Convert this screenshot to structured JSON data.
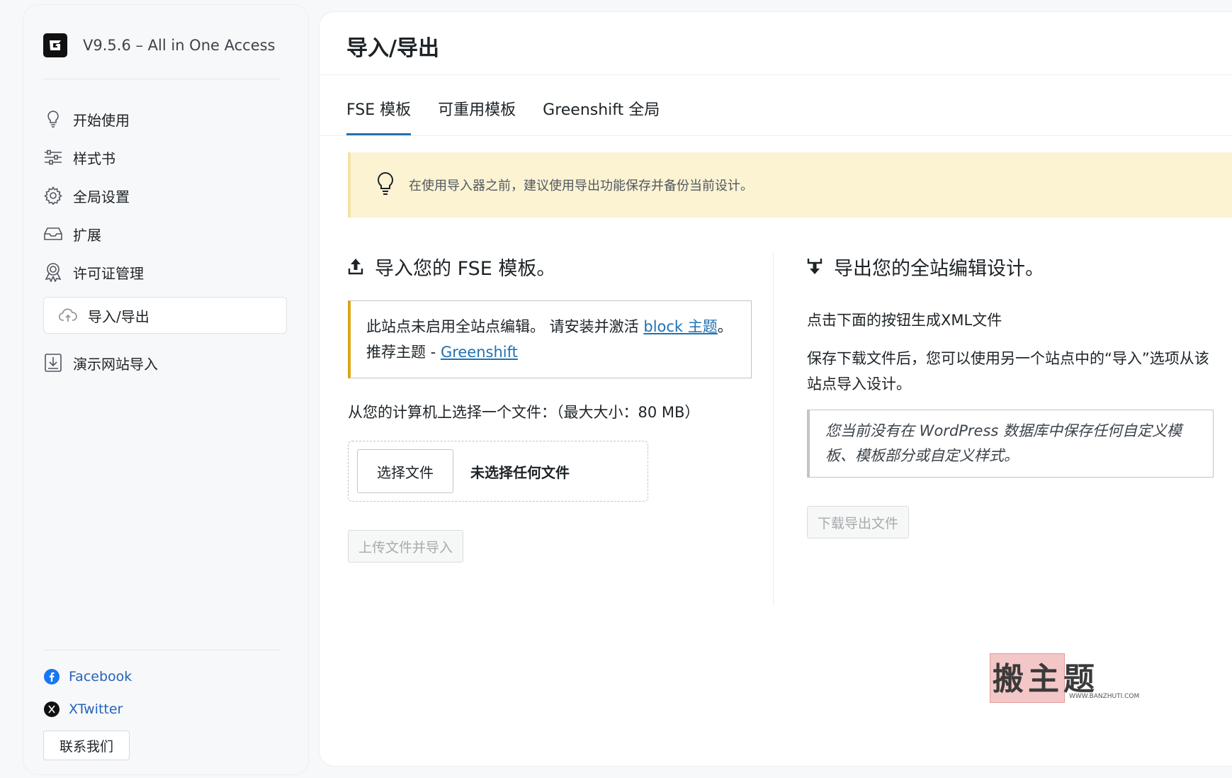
{
  "sidebar": {
    "brand": "V9.5.6 – All in One Access",
    "nav": [
      {
        "label": "开始使用",
        "icon": "lightbulb-icon"
      },
      {
        "label": "样式书",
        "icon": "sliders-icon"
      },
      {
        "label": "全局设置",
        "icon": "gear-icon"
      },
      {
        "label": "扩展",
        "icon": "inbox-icon"
      },
      {
        "label": "许可证管理",
        "icon": "award-icon"
      },
      {
        "label": "导入/导出",
        "icon": "cloud-upload-icon",
        "active": true
      },
      {
        "label": "演示网站导入",
        "icon": "download-icon"
      }
    ],
    "facebook": "Facebook",
    "twitter": "XTwitter",
    "contact": "联系我们"
  },
  "main": {
    "title": "导入/导出",
    "tabs": [
      "FSE 模板",
      "可重用模板",
      "Greenshift 全局"
    ],
    "notice": "在使用导入器之前，建议使用导出功能保存并备份当前设计。",
    "import": {
      "title": "导入您的 FSE 模板。",
      "warn_text1": "此站点未启用全站点编辑。 请安装并激活 ",
      "warn_link1": "block 主题",
      "warn_text2": "。 推荐主题 - ",
      "warn_link2": "Greenshift",
      "file_label": "从您的计算机上选择一个文件：（最大大小：80 MB）",
      "choose_btn": "选择文件",
      "no_file": "未选择任何文件",
      "submit_btn": "上传文件并导入"
    },
    "export": {
      "title": "导出您的全站编辑设计。",
      "desc1": "点击下面的按钮生成XML文件",
      "desc2": "保存下载文件后，您可以使用另一个站点中的“导入”选项从该站点导入设计。",
      "empty_note": "您当前没有在 WordPress 数据库中保存任何自定义模板、模板部分或自定义样式。",
      "download_btn": "下载导出文件"
    }
  },
  "watermark": {
    "main": "搬主题",
    "url": "WWW.BANZHUTI.COM"
  },
  "colors": {
    "accent": "#2271b1",
    "notice_bg": "#fcf3d3",
    "warn_border": "#dba617",
    "link": "#2563b8"
  }
}
